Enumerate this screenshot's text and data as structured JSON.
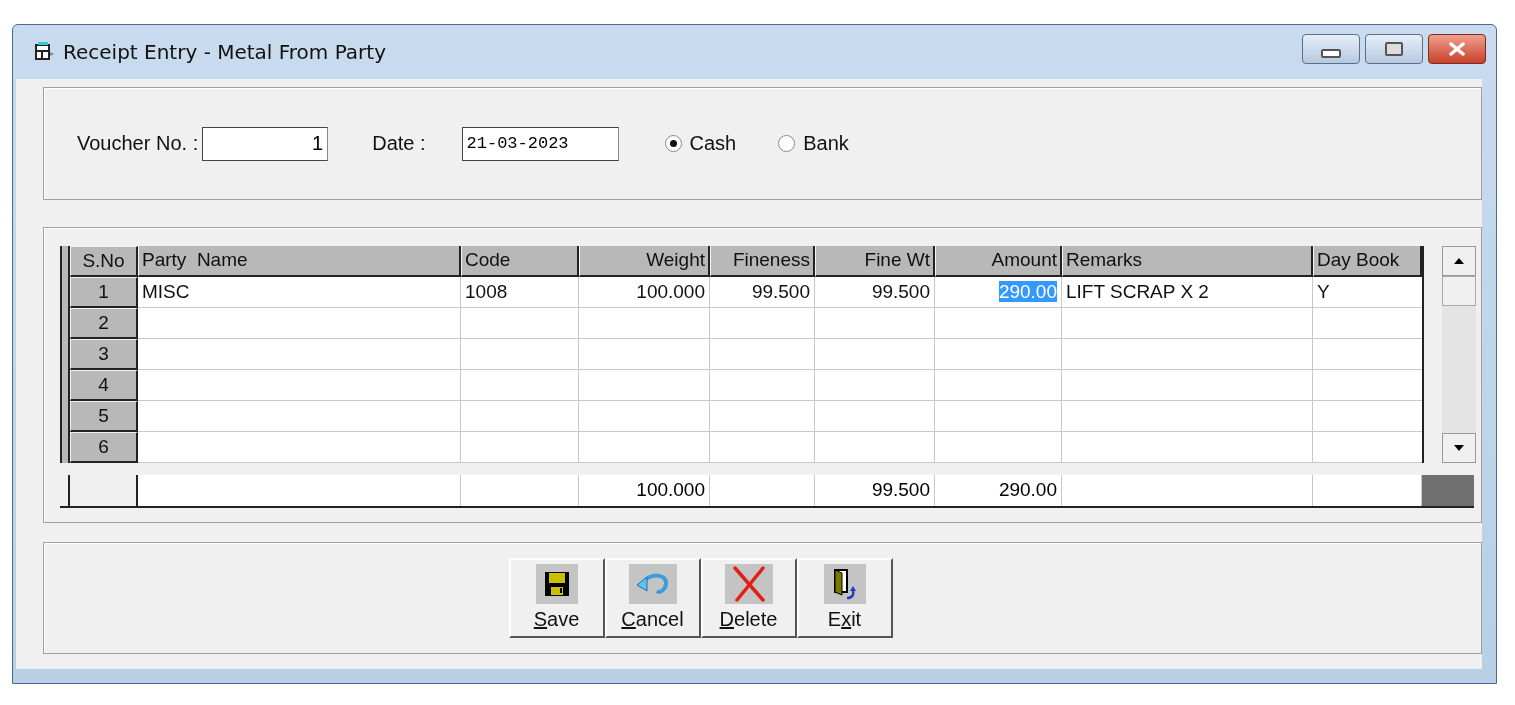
{
  "window": {
    "title": "Receipt Entry - Metal From Party"
  },
  "voucher": {
    "label": "Voucher No. :",
    "value": "1"
  },
  "date": {
    "label": "Date :",
    "value": "21-03-2023"
  },
  "payment_modes": [
    {
      "label": "Cash",
      "selected": true
    },
    {
      "label": "Bank",
      "selected": false
    }
  ],
  "grid": {
    "row_header": "S.No",
    "columns": [
      "Party  Name",
      "Code",
      "Weight",
      "Fineness",
      "Fine Wt",
      "Amount",
      "Remarks",
      "Day Book"
    ],
    "rows": [
      {
        "sno": "1",
        "cells": [
          {
            "text": "MISC",
            "selected": false
          },
          {
            "text": "1008",
            "selected": false
          },
          {
            "text": "100.000",
            "selected": false
          },
          {
            "text": "99.500",
            "selected": false
          },
          {
            "text": "99.500",
            "selected": false
          },
          {
            "text": "290.00",
            "selected": true
          },
          {
            "text": "LIFT SCRAP X 2",
            "selected": false
          },
          {
            "text": "Y",
            "selected": false
          }
        ]
      },
      {
        "sno": "2",
        "cells": []
      },
      {
        "sno": "3",
        "cells": []
      },
      {
        "sno": "4",
        "cells": []
      },
      {
        "sno": "5",
        "cells": []
      },
      {
        "sno": "6",
        "cells": []
      }
    ],
    "totals": [
      "100.000",
      "99.500",
      "290.00"
    ]
  },
  "buttons": [
    {
      "kind": "save",
      "label": "Save"
    },
    {
      "kind": "cancel",
      "label": "Cancel"
    },
    {
      "kind": "delete",
      "label": "Delete"
    },
    {
      "kind": "exit",
      "label": "Exit"
    }
  ]
}
